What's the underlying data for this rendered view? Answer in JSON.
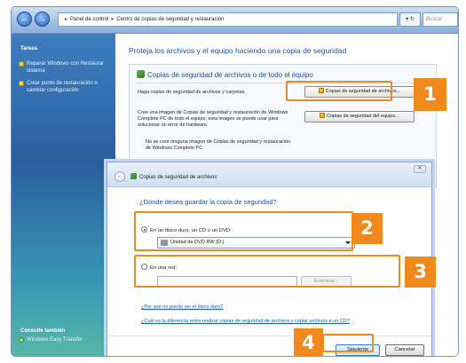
{
  "address_bar": {
    "breadcrumb": [
      "Panel de control",
      "Centro de copias de seguridad y restauración"
    ],
    "refresh_label": "▾ ↻",
    "search_placeholder": "Buscar"
  },
  "sidebar": {
    "tasks_title": "Tareas",
    "items": [
      {
        "label": "Reparar Windows con Restaurar sistema"
      },
      {
        "label": "Crear punto de restauración o cambiar configuración"
      }
    ],
    "see_also_title": "Consulte también",
    "see_also_item": "Windows Easy Transfer"
  },
  "main": {
    "title": "Proteja los archivos y el equipo haciendo una copia de seguridad",
    "panel_heading": "Copias de seguridad de archivos o de todo el equipo",
    "files_text": "Haga copias de seguridad de archivos y carpetas.",
    "files_button": "Copias de seguridad de archivos...",
    "complete_text": "Cree una imagen de Copias de seguridad y restauración de Windows Complete PC de todo el equipo; esta imagen se puede usar para solucionar un error de hardware.",
    "complete_button": "Copias de seguridad del equipo...",
    "no_image_text": "No se creó ninguna imagen de Copias de seguridad y restauración de Windows Complete PC."
  },
  "dialog": {
    "title": "Copias de seguridad de archivos",
    "question": "¿Dónde desea guardar la copia de seguridad?",
    "option_disk": "En un disco duro, un CD o un DVD:",
    "drive_selected": "Unidad de DVD RW (D:)",
    "option_network": "En una red:",
    "browse_button": "Examinar...",
    "link_why": "¿Por qué no puedo ver el disco duro?",
    "link_diff": "¿Cuál es la diferencia entre realizar copias de seguridad de archivos y copiar archivos a un CD?",
    "next_button": "Siguiente",
    "cancel_button": "Cancelar"
  },
  "callouts": [
    "1",
    "2",
    "3",
    "4"
  ],
  "colors": {
    "callout": "#f08a1c",
    "link": "#1a55b0",
    "heading": "#1e4f95"
  }
}
